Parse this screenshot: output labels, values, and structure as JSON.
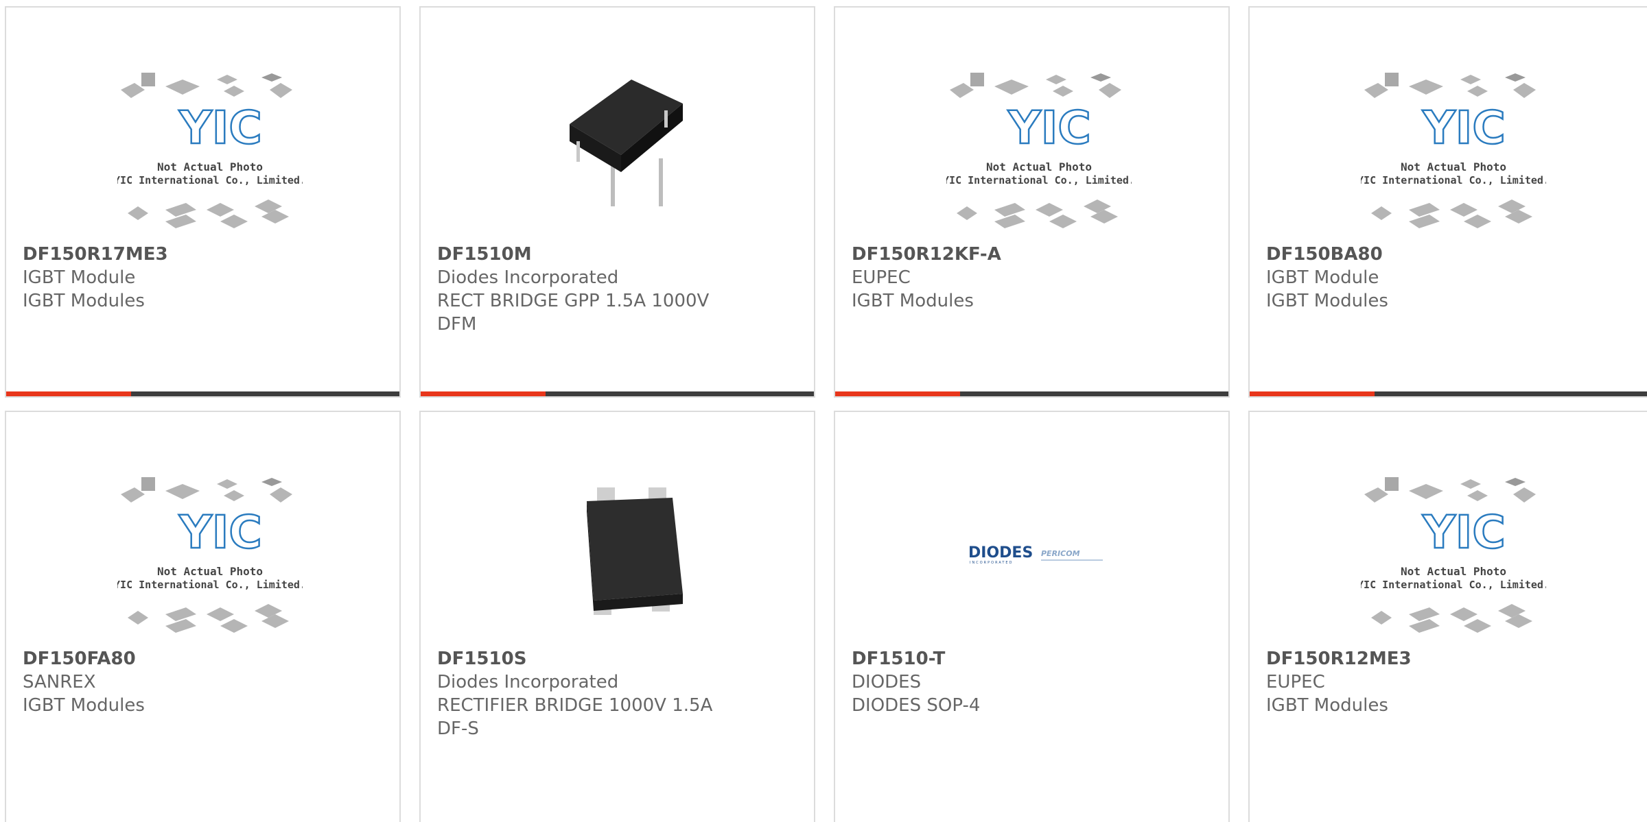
{
  "accent_color": "#e8361b",
  "bar_color": "#3d3d3d",
  "placeholder_logo_text": "YIC",
  "placeholder_caption_1": "Not Actual Photo",
  "placeholder_caption_2": "YIC International Co., Limited.",
  "products": [
    {
      "part": "DF150R17ME3",
      "line1": "IGBT Module",
      "line2": "IGBT Modules",
      "line3": "",
      "image": "placeholder"
    },
    {
      "part": "DF1510M",
      "line1": "Diodes Incorporated",
      "line2": "RECT BRIDGE GPP 1.5A 1000V",
      "line3": "DFM",
      "image": "dfm-package"
    },
    {
      "part": "DF150R12KF-A",
      "line1": "EUPEC",
      "line2": "IGBT Modules",
      "line3": "",
      "image": "placeholder"
    },
    {
      "part": "DF150BA80",
      "line1": "IGBT Module",
      "line2": "IGBT Modules",
      "line3": "",
      "image": "placeholder"
    },
    {
      "part": "DF150FA80",
      "line1": "SANREX",
      "line2": "IGBT Modules",
      "line3": "",
      "image": "placeholder"
    },
    {
      "part": "DF1510S",
      "line1": "Diodes Incorporated",
      "line2": "RECTIFIER BRIDGE 1000V 1.5A",
      "line3": "DF-S",
      "image": "dfs-package"
    },
    {
      "part": "DF1510-T",
      "line1": "DIODES",
      "line2": "DIODES SOP-4",
      "line3": "",
      "image": "diodes-logo"
    },
    {
      "part": "DF150R12ME3",
      "line1": "EUPEC",
      "line2": "IGBT Modules",
      "line3": "",
      "image": "placeholder"
    }
  ],
  "diodes_logo_text": "DIODES",
  "diodes_logo_sub": "INCORPORATED",
  "pericom_logo_text": "PERICOM"
}
